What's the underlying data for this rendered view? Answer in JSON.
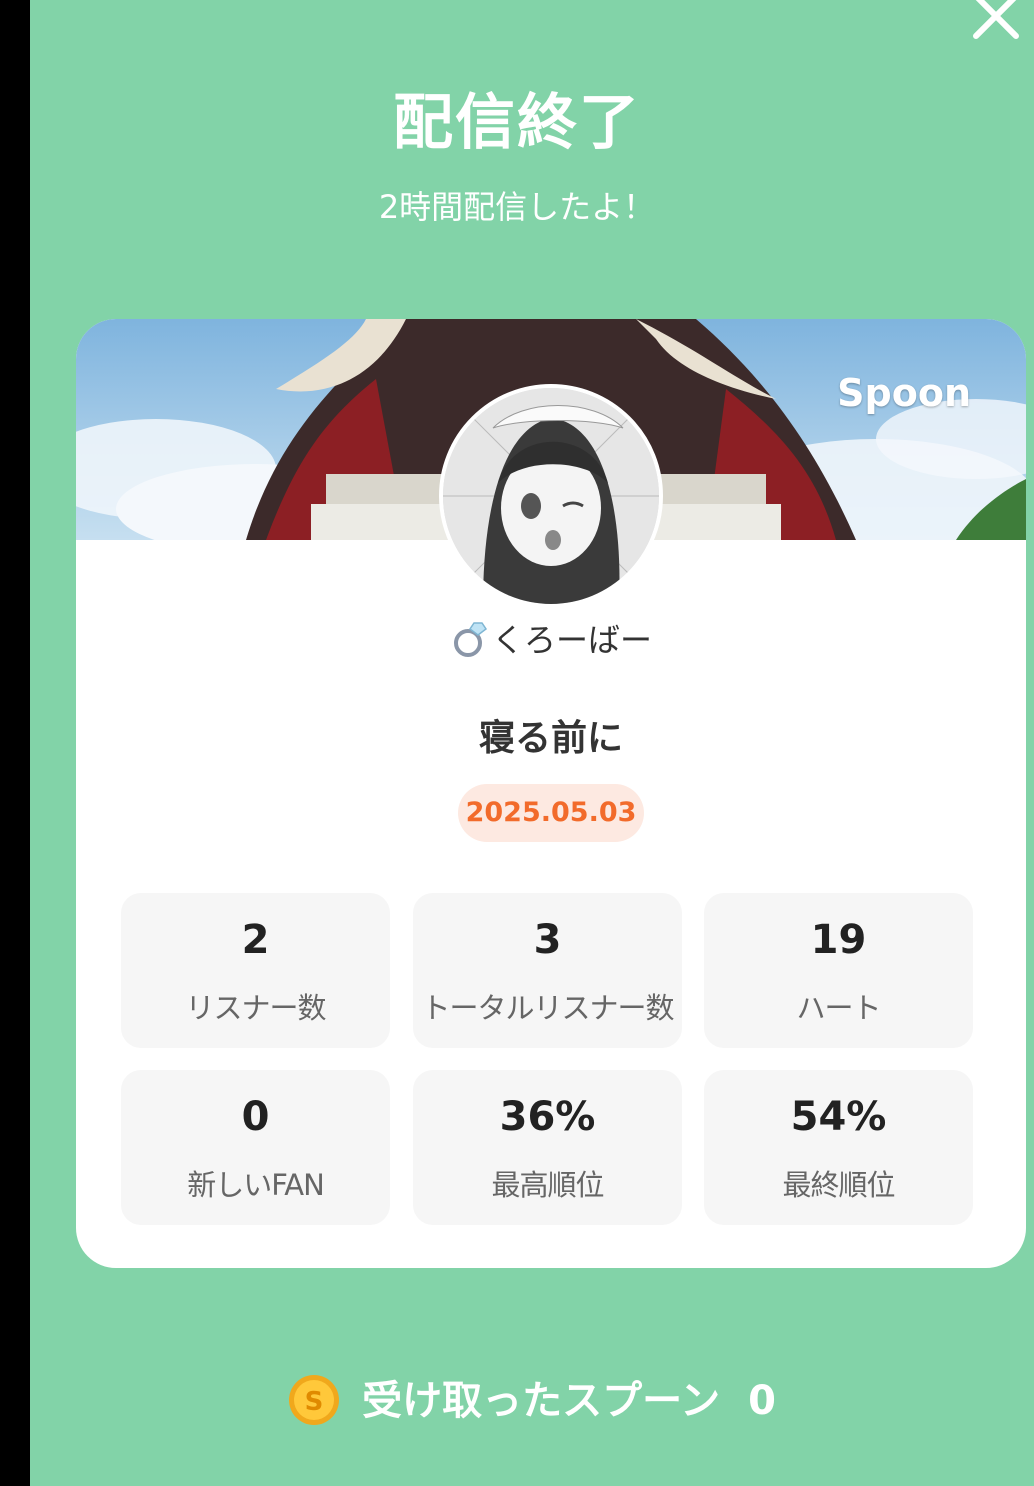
{
  "header": {
    "title": "配信終了",
    "subtitle": "2時間配信したよ！"
  },
  "card": {
    "brand": "Spoon",
    "username_icon": "ring-icon",
    "username": "くろーばー",
    "live_title": "寝る前に",
    "date": "2025.05.03"
  },
  "stats": [
    {
      "value": "2",
      "label": "リスナー数"
    },
    {
      "value": "3",
      "label": "トータルリスナー数"
    },
    {
      "value": "19",
      "label": "ハート"
    },
    {
      "value": "0",
      "label": "新しいFAN"
    },
    {
      "value": "36%",
      "label": "最高順位"
    },
    {
      "value": "54%",
      "label": "最終順位"
    }
  ],
  "spoons": {
    "label": "受け取ったスプーン",
    "count": "0",
    "icon": "spoon-coin-icon"
  },
  "colors": {
    "background": "#82d3a8",
    "date_text": "#f26b2b",
    "date_bg": "#fde9e1"
  }
}
